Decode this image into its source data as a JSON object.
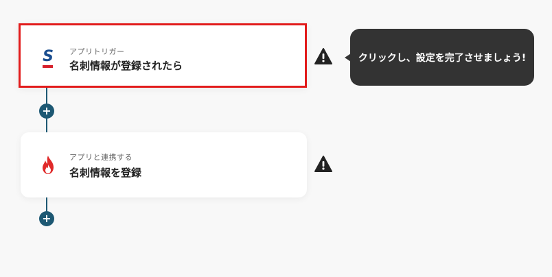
{
  "flow": {
    "steps": [
      {
        "app_icon": "sansan-icon",
        "type_label": "アプリトリガー",
        "title": "名刺情報が登録されたら",
        "selected": true,
        "warning_icon": "warning-icon"
      },
      {
        "app_icon": "flame-icon",
        "type_label": "アプリと連携する",
        "title": "名刺情報を登録",
        "selected": false,
        "warning_icon": "warning-icon"
      }
    ],
    "add_button_label": "+"
  },
  "tooltip": {
    "text": "クリックし、設定を完了させましょう!"
  },
  "colors": {
    "background": "#f8f8f8",
    "selected_border": "#e21b1b",
    "connector": "#1d5873",
    "tooltip_bg": "#333333",
    "sansan_blue": "#1a4d8f",
    "sansan_red": "#d6202b",
    "flame_red": "#e02a2a"
  }
}
